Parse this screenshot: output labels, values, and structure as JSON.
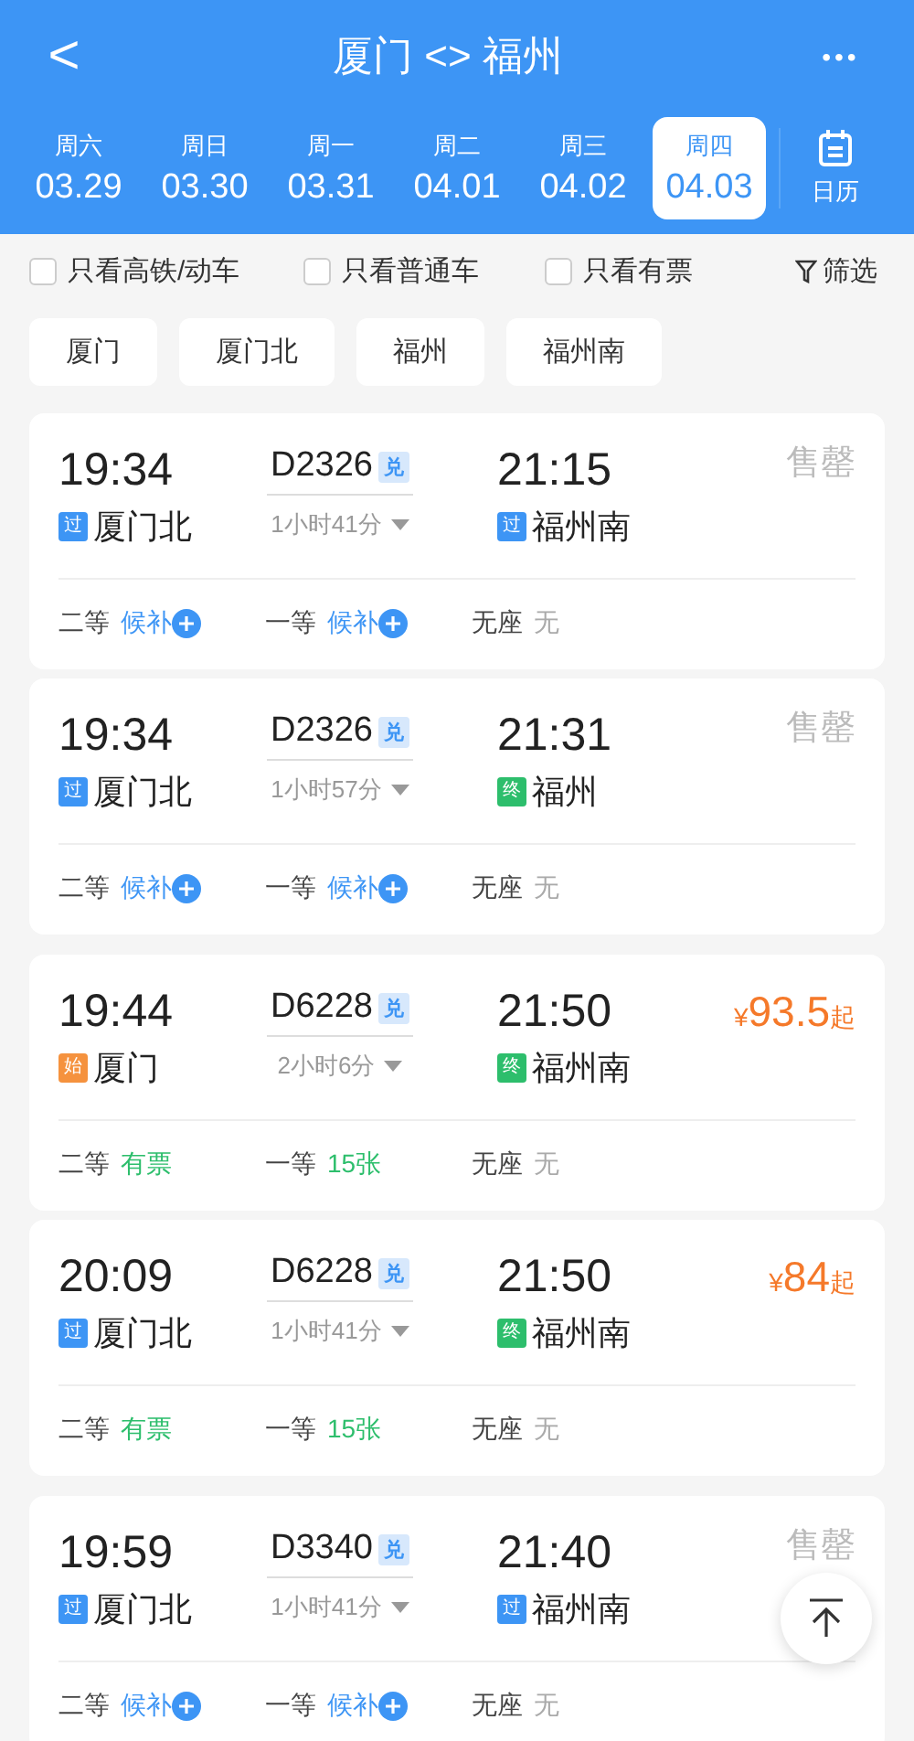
{
  "header": {
    "back": "<",
    "title": "厦门 <> 福州",
    "more": "•••"
  },
  "dates": [
    {
      "weekday": "周六",
      "date": "03.29",
      "selected": false
    },
    {
      "weekday": "周日",
      "date": "03.30",
      "selected": false
    },
    {
      "weekday": "周一",
      "date": "03.31",
      "selected": false
    },
    {
      "weekday": "周二",
      "date": "04.01",
      "selected": false
    },
    {
      "weekday": "周三",
      "date": "04.02",
      "selected": false
    },
    {
      "weekday": "周四",
      "date": "04.03",
      "selected": true
    }
  ],
  "calendar": {
    "label": "日历"
  },
  "filters": [
    {
      "label": "只看高铁/动车",
      "checked": false
    },
    {
      "label": "只看普通车",
      "checked": false
    },
    {
      "label": "只看有票",
      "checked": false
    }
  ],
  "filter_button": {
    "label": "筛选"
  },
  "stations": [
    "厦门",
    "厦门北",
    "福州",
    "福州南"
  ],
  "trains": [
    {
      "depart": "19:34",
      "from_tag": {
        "kind": "pass",
        "text": "过"
      },
      "from": "厦门北",
      "number": "D2326",
      "badge": "兑",
      "duration": "1小时41分",
      "arrive": "21:15",
      "to_tag": {
        "kind": "pass",
        "text": "过"
      },
      "to": "福州南",
      "fare": {
        "kind": "soldout",
        "text": "售罄"
      },
      "seats": [
        {
          "class": "二等",
          "kind": "waitlist",
          "text": "候补"
        },
        {
          "class": "一等",
          "kind": "waitlist",
          "text": "候补"
        },
        {
          "class": "无座",
          "kind": "none",
          "text": "无"
        }
      ]
    },
    {
      "depart": "19:34",
      "from_tag": {
        "kind": "pass",
        "text": "过"
      },
      "from": "厦门北",
      "number": "D2326",
      "badge": "兑",
      "duration": "1小时57分",
      "arrive": "21:31",
      "to_tag": {
        "kind": "end",
        "text": "终"
      },
      "to": "福州",
      "fare": {
        "kind": "soldout",
        "text": "售罄"
      },
      "seats": [
        {
          "class": "二等",
          "kind": "waitlist",
          "text": "候补"
        },
        {
          "class": "一等",
          "kind": "waitlist",
          "text": "候补"
        },
        {
          "class": "无座",
          "kind": "none",
          "text": "无"
        }
      ]
    },
    {
      "depart": "19:44",
      "from_tag": {
        "kind": "start",
        "text": "始"
      },
      "from": "厦门",
      "number": "D6228",
      "badge": "兑",
      "duration": "2小时6分",
      "arrive": "21:50",
      "to_tag": {
        "kind": "end",
        "text": "终"
      },
      "to": "福州南",
      "fare": {
        "kind": "price",
        "symbol": "¥",
        "text": "93.5",
        "suffix": "起"
      },
      "seats": [
        {
          "class": "二等",
          "kind": "available",
          "text": "有票"
        },
        {
          "class": "一等",
          "kind": "available",
          "text": "15张"
        },
        {
          "class": "无座",
          "kind": "none",
          "text": "无"
        }
      ]
    },
    {
      "depart": "20:09",
      "from_tag": {
        "kind": "pass",
        "text": "过"
      },
      "from": "厦门北",
      "number": "D6228",
      "badge": "兑",
      "duration": "1小时41分",
      "arrive": "21:50",
      "to_tag": {
        "kind": "end",
        "text": "终"
      },
      "to": "福州南",
      "fare": {
        "kind": "price",
        "symbol": "¥",
        "text": "84",
        "suffix": "起"
      },
      "seats": [
        {
          "class": "二等",
          "kind": "available",
          "text": "有票"
        },
        {
          "class": "一等",
          "kind": "available",
          "text": "15张"
        },
        {
          "class": "无座",
          "kind": "none",
          "text": "无"
        }
      ]
    },
    {
      "depart": "19:59",
      "from_tag": {
        "kind": "pass",
        "text": "过"
      },
      "from": "厦门北",
      "number": "D3340",
      "badge": "兑",
      "duration": "1小时41分",
      "arrive": "21:40",
      "to_tag": {
        "kind": "pass",
        "text": "过"
      },
      "to": "福州南",
      "fare": {
        "kind": "soldout",
        "text": "售罄"
      },
      "seats": [
        {
          "class": "二等",
          "kind": "waitlist",
          "text": "候补"
        },
        {
          "class": "一等",
          "kind": "waitlist",
          "text": "候补"
        },
        {
          "class": "无座",
          "kind": "none",
          "text": "无"
        }
      ]
    }
  ]
}
